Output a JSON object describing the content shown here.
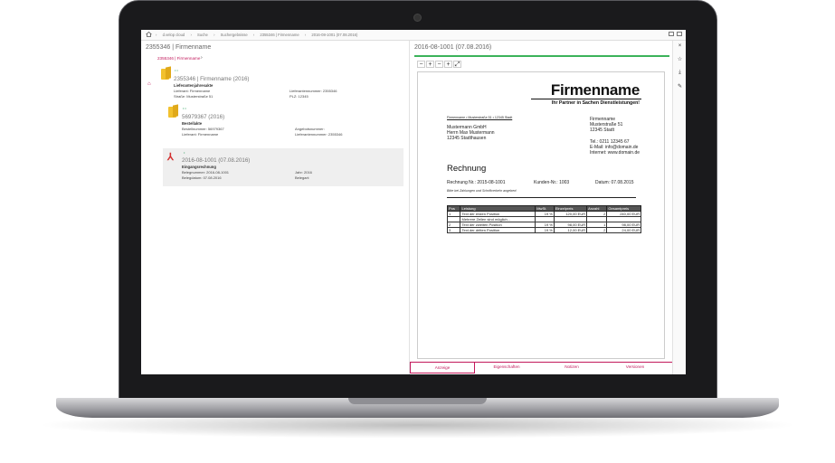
{
  "breadcrumb": [
    "d.velop cloud",
    "Suche",
    "Suchergebnisse",
    "2355346 | Firmenname",
    "2016-08-1001 (07.08.2016)"
  ],
  "left": {
    "title": "2355346 | Firmenname",
    "subtitle": "2355346 | Firmenname",
    "nodes": [
      {
        "title": "2355346 | Firmenname (2016)",
        "type": "Lieferantenjahresakte",
        "fields": [
          {
            "label": "Lieferant: Firmenname",
            "value": "Lieferantennummer: 2355346"
          },
          {
            "label": "Straße: Musterstraße 51",
            "value": "PLZ: 12345"
          }
        ]
      },
      {
        "title": "56979367 (2016)",
        "type": "Bestellakte",
        "fields": [
          {
            "label": "Bestellnummer: 56979367",
            "value": "Angebotsnummer:"
          },
          {
            "label": "Lieferant: Firmenname",
            "value": "Lieferantennummer: 2355346"
          }
        ]
      },
      {
        "title": "2016-08-1001 (07.08.2016)",
        "type": "Eingangsrechnung",
        "fields": [
          {
            "label": "Belegnummer: 2016-08-1001",
            "value": "Jahr: 2016"
          },
          {
            "label": "Belegdatum: 07.08.2016",
            "value": "Belegart:"
          }
        ]
      }
    ]
  },
  "right": {
    "title": "2016-08-1001 (07.08.2016)",
    "zoom_buttons": [
      "−",
      "+",
      "−",
      "+",
      "⤢"
    ],
    "tabs": [
      "Anzeige",
      "Eigenschaften",
      "Notizen",
      "Versionen"
    ]
  },
  "invoice": {
    "brand": "Firmenname",
    "tagline": "Ihr Partner in Sachen Dienstleistungen!",
    "sender_line": "Firmenname • Musterstraße 51 • 12345 Stadt",
    "recipient": [
      "Mustermann GmbH",
      "Herrn Max Mustermann",
      "12345 Stadthausen"
    ],
    "firm_address": [
      "Firmenname",
      "Musterstraße 51",
      "12345 Stadt"
    ],
    "contact": [
      "Tel.: 0211 12345 67",
      "E-Mail: info@domain.de",
      "Internet: www.domain.de"
    ],
    "title": "Rechnung",
    "number": "Rechnung Nr.: 2015-08-1001",
    "customer": "Kunden-Nr.: 1003",
    "date": "Datum: 07.08.2015",
    "note": "Bitte bei Zahlungen und Schriftverkehr angeben!",
    "table": {
      "headers": [
        "Pos",
        "Leistung",
        "MwSt.",
        "Einzelpreis",
        "Anzahl",
        "Gesamtpreis"
      ],
      "rows": [
        [
          "1",
          "Text der ersten Position",
          "19 %",
          "120,00 EUR",
          "2",
          "240,00 EUR"
        ],
        [
          "",
          "Mehrere Zeilen sind möglich...",
          "",
          "",
          "",
          ""
        ],
        [
          "2",
          "Text der zweiten Position",
          "19 %",
          "98,00 EUR",
          "1",
          "98,00 EUR"
        ],
        [
          "3",
          "Text der dritten Position",
          "19 %",
          "12,00 EUR",
          "2",
          "24,00 EUR"
        ]
      ]
    }
  },
  "sidebar_icons": [
    "close-icon",
    "star-icon",
    "download-icon",
    "pin-icon"
  ]
}
